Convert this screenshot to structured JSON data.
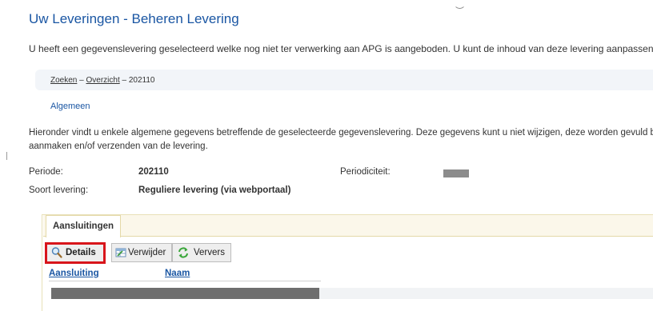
{
  "page": {
    "title": "Uw Leveringen - Beheren Levering",
    "intro": "U heeft een gegevenslevering geselecteerd welke nog niet ter verwerking aan APG is aangeboden. U kunt de inhoud van deze levering aanpassen."
  },
  "breadcrumb": {
    "items": [
      {
        "label": "Zoeken",
        "link": true
      },
      {
        "label": "Overzicht",
        "link": true
      },
      {
        "label": "202110",
        "link": false
      }
    ],
    "separator": "–"
  },
  "section": {
    "label": "Algemeen"
  },
  "description": {
    "line1": "Hieronder vindt u enkele algemene gegevens betreffende de geselecteerde gegevenslevering. Deze gegevens kunt u niet wijzigen, deze worden gevuld bij h",
    "line2": "aanmaken en/of verzenden van de levering."
  },
  "details": {
    "periode_label": "Periode:",
    "periode_value": "202110",
    "soort_label": "Soort levering:",
    "soort_value": "Reguliere levering (via webportaal)",
    "periodiciteit_label": "Periodiciteit:"
  },
  "tabs": [
    {
      "label": "Aansluitingen",
      "active": true
    }
  ],
  "toolbar": {
    "details_label": "Details",
    "verwijder_label": "Verwijder",
    "ververs_label": "Ververs"
  },
  "table": {
    "columns": [
      "Aansluiting",
      "Naam"
    ]
  },
  "colors": {
    "title_blue": "#1a56a3",
    "highlight_red": "#d8151b",
    "tab_border": "#e4d9a8",
    "breadcrumb_bg": "#f2f5f9"
  },
  "icons": {
    "details": "magnifier-icon",
    "verwijder": "delete-table-icon",
    "ververs": "refresh-icon"
  }
}
